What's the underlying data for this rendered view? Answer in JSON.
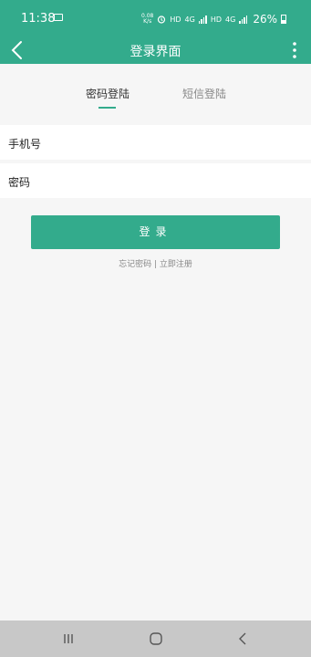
{
  "status_bar": {
    "time": "11:38",
    "net_speed": "0.08\nK/s",
    "hd1": "HD",
    "net1": "4G",
    "hd2": "HD",
    "net2": "4G",
    "battery": "26%"
  },
  "app_bar": {
    "title": "登录界面",
    "back_icon": "chevron-left-icon",
    "more_icon": "more-vertical-icon"
  },
  "tabs": [
    {
      "label": "密码登陆",
      "active": true
    },
    {
      "label": "短信登陆",
      "active": false
    }
  ],
  "form": {
    "phone_label": "手机号",
    "phone_value": "",
    "password_label": "密码",
    "password_value": ""
  },
  "login_button": "登录",
  "links": {
    "forgot": "忘记密码",
    "separator": "|",
    "register": "立即注册"
  },
  "colors": {
    "accent": "#33ab8c",
    "background": "#f6f6f6",
    "nav_bar": "#c8c8c8"
  }
}
